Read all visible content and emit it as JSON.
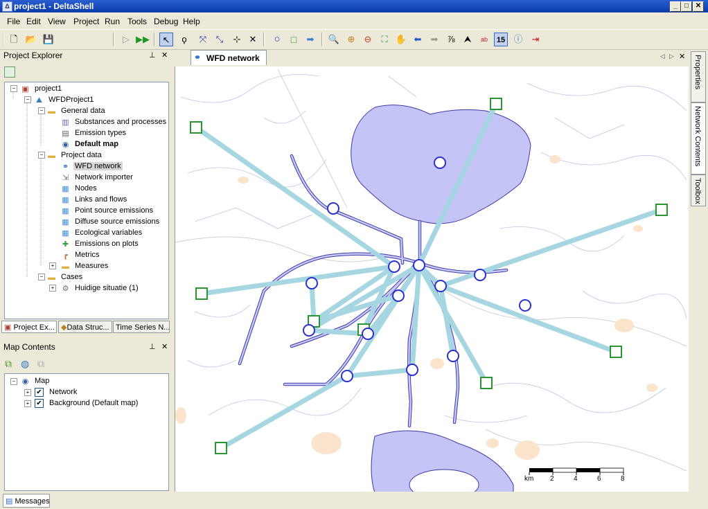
{
  "window": {
    "title": "project1 - DeltaShell",
    "app_icon": "deltashell-icon"
  },
  "menu": [
    "File",
    "Edit",
    "View",
    "Project",
    "Run",
    "Tools",
    "Debug",
    "Help"
  ],
  "project_explorer": {
    "title": "Project Explorer",
    "tree": [
      {
        "label": "project1",
        "icon": "project-icon"
      },
      {
        "label": "WFDProject1",
        "icon": "wfd-project-icon"
      },
      {
        "label": "General data",
        "icon": "folder-icon"
      },
      {
        "label": "Substances and processes",
        "icon": "chart-icon"
      },
      {
        "label": "Emission types",
        "icon": "list-icon"
      },
      {
        "label": "Default map",
        "icon": "globe-icon"
      },
      {
        "label": "Project data",
        "icon": "folder-icon"
      },
      {
        "label": "WFD network",
        "icon": "network-icon"
      },
      {
        "label": "Network importer",
        "icon": "importer-icon"
      },
      {
        "label": "Nodes",
        "icon": "table-icon"
      },
      {
        "label": "Links and flows",
        "icon": "table-icon"
      },
      {
        "label": "Point source emissions",
        "icon": "table-icon"
      },
      {
        "label": "Diffuse source emissions",
        "icon": "table-icon"
      },
      {
        "label": "Ecological variables",
        "icon": "table-icon"
      },
      {
        "label": "Emissions on plots",
        "icon": "puzzle-icon"
      },
      {
        "label": "Metrics",
        "icon": "metrics-icon"
      },
      {
        "label": "Measures",
        "icon": "folder-icon"
      },
      {
        "label": "Cases",
        "icon": "folder-icon"
      },
      {
        "label": "Huidige situatie (1)",
        "icon": "gear-icon"
      }
    ],
    "tabs": [
      "Project Ex...",
      "Data Struc...",
      "Time Series N..."
    ]
  },
  "map_contents": {
    "title": "Map Contents",
    "tree": [
      {
        "label": "Map"
      },
      {
        "label": "Network",
        "checked": true
      },
      {
        "label": "Background (Default map)",
        "checked": true
      }
    ]
  },
  "document": {
    "tab_label": "WFD network"
  },
  "right_tabs": [
    "Properties",
    "Network Contents",
    "Toolbox"
  ],
  "scalebar": {
    "labels": [
      "km",
      "2",
      "4",
      "6",
      "8"
    ]
  },
  "status": {
    "messages_tab": "Messages"
  },
  "toolbar": {
    "zoom_level": "15"
  },
  "colors": {
    "water": "#c6c6f5",
    "link": "#9fd4e0",
    "node_stroke": "#2b2fd0",
    "square_stroke": "#2a9632",
    "title_bar": "#0a3aa8"
  }
}
